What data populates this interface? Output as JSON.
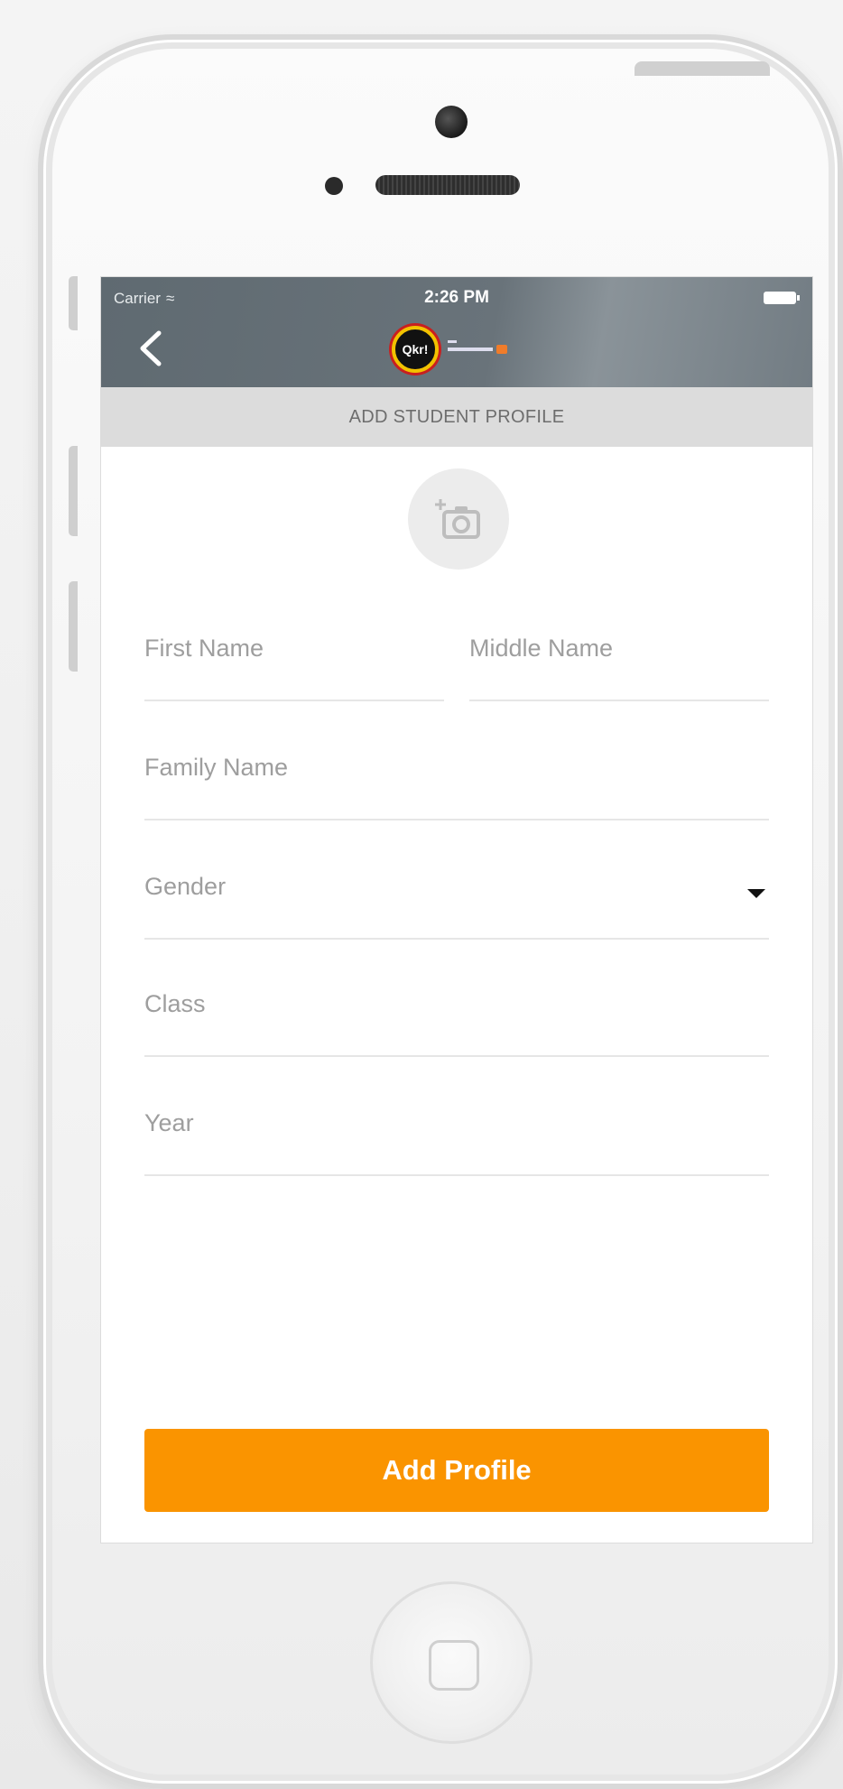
{
  "status_bar": {
    "carrier": "Carrier",
    "time": "2:26 PM"
  },
  "nav": {
    "logo_text": "Qkr!"
  },
  "header": {
    "title": "ADD STUDENT PROFILE"
  },
  "form": {
    "first_name_placeholder": "First Name",
    "middle_name_placeholder": "Middle Name",
    "family_name_placeholder": "Family Name",
    "gender_placeholder": "Gender",
    "class_placeholder": "Class",
    "year_placeholder": "Year"
  },
  "actions": {
    "add_profile_label": "Add Profile"
  },
  "colors": {
    "accent": "#fa9400",
    "nav_bar": "#69737a",
    "subheader_bg": "#dcdcdc"
  }
}
